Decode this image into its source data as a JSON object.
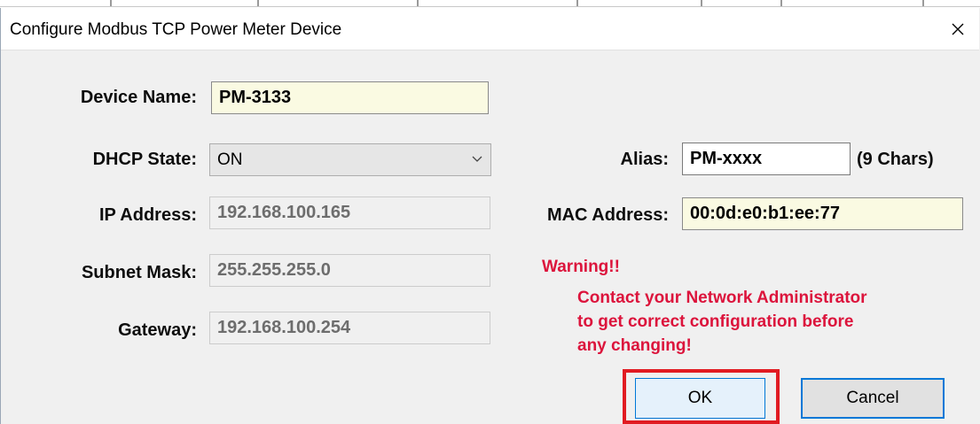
{
  "window": {
    "title": "Configure Modbus TCP Power Meter Device"
  },
  "form": {
    "device_name": {
      "label": "Device Name:",
      "value": "PM-3133"
    },
    "dhcp_state": {
      "label": "DHCP State:",
      "value": "ON"
    },
    "ip_address": {
      "label": "IP Address:",
      "value": "192.168.100.165"
    },
    "subnet_mask": {
      "label": "Subnet Mask:",
      "value": "255.255.255.0"
    },
    "gateway": {
      "label": "Gateway:",
      "value": "192.168.100.254"
    },
    "alias": {
      "label": "Alias:",
      "value": "PM-xxxx",
      "hint": "(9 Chars)"
    },
    "mac_address": {
      "label": "MAC Address:",
      "value": "00:0d:e0:b1:ee:77"
    }
  },
  "warning": {
    "title": "Warning!!",
    "lines": [
      "Contact your Network Administrator",
      "to get correct configuration before",
      "any changing!"
    ]
  },
  "buttons": {
    "ok": "OK",
    "cancel": "Cancel"
  },
  "icons": {
    "close": "close-icon",
    "dropdown": "chevron-down-icon"
  },
  "colors": {
    "warning_text": "#dc143c",
    "highlight_border": "#e11b22",
    "focus_border": "#0078d7",
    "editable_bg": "#fafae2"
  }
}
